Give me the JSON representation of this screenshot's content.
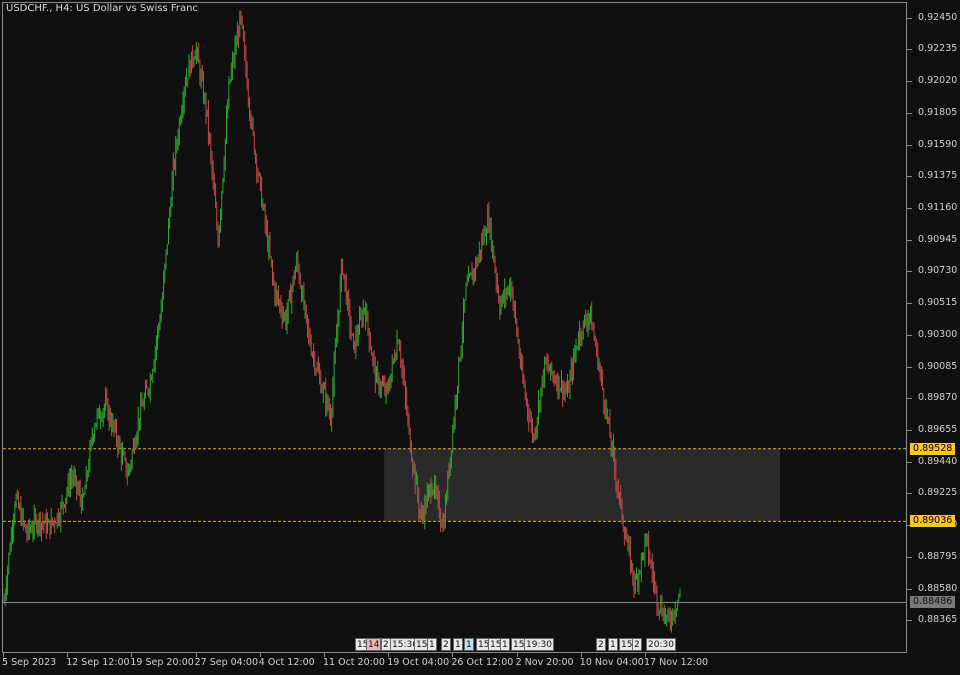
{
  "title": "USDCHF., H4:  US Dollar vs Swiss Franc",
  "colors": {
    "background": "#101010",
    "bull": "#2fa82f",
    "bear": "#c04a4a",
    "level_line": "#e0b030",
    "zone": "#2a2a2a",
    "current_line": "#8c8c8c"
  },
  "price_tags": [
    {
      "label": "0.89528",
      "style": "gold"
    },
    {
      "label": "0.89036",
      "style": "gold"
    },
    {
      "label": "0.88486",
      "style": "grey"
    }
  ],
  "event_markers": [
    "15",
    "14",
    "2",
    "15:30",
    "15",
    "1",
    "2",
    "1",
    "1",
    "15",
    "15",
    "1",
    "15",
    "19:30",
    "2",
    "1",
    "15",
    "2",
    "20:30"
  ],
  "chart_data": {
    "type": "candlestick",
    "symbol": "USDCHF.",
    "timeframe": "H4",
    "description": "US Dollar vs Swiss Franc",
    "ylim": [
      0.8815,
      0.9255
    ],
    "yticks": [
      0.9245,
      0.92235,
      0.9202,
      0.91805,
      0.9159,
      0.91375,
      0.9116,
      0.90945,
      0.9073,
      0.90515,
      0.903,
      0.90085,
      0.8987,
      0.89655,
      0.8944,
      0.89225,
      0.8901,
      0.88795,
      0.8858,
      0.88365
    ],
    "ytick_labels": [
      "0.92450",
      "0.92235",
      "0.92020",
      "0.91805",
      "0.91590",
      "0.91375",
      "0.91160",
      "0.90945",
      "0.90730",
      "0.90515",
      "0.90300",
      "0.90085",
      "0.89870",
      "0.89655",
      "0.89440",
      "0.89225",
      "0.89010",
      "0.88795",
      "0.88580",
      "0.88365"
    ],
    "xtick_labels": [
      "5 Sep 2023",
      "12 Sep 12:00",
      "19 Sep 20:00",
      "27 Sep 04:00",
      "4 Oct 12:00",
      "11 Oct 20:00",
      "19 Oct 04:00",
      "26 Oct 12:00",
      "2 Nov 20:00",
      "10 Nov 04:00",
      "17 Nov 12:00"
    ],
    "levels": [
      0.89528,
      0.89036
    ],
    "current_price": 0.88486,
    "zone": {
      "from": "19 Oct 04:00",
      "to_after": "17 Nov 12:00",
      "high": 0.89528,
      "low": 0.89036
    },
    "path": [
      0.885,
      0.892,
      0.8895,
      0.8905,
      0.89,
      0.891,
      0.8935,
      0.8915,
      0.897,
      0.8983,
      0.896,
      0.8935,
      0.8975,
      0.9,
      0.905,
      0.914,
      0.92,
      0.9225,
      0.918,
      0.9095,
      0.92,
      0.9245,
      0.917,
      0.9115,
      0.906,
      0.904,
      0.908,
      0.903,
      0.9,
      0.8975,
      0.908,
      0.902,
      0.905,
      0.9,
      0.899,
      0.903,
      0.896,
      0.8905,
      0.893,
      0.89,
      0.898,
      0.906,
      0.908,
      0.911,
      0.905,
      0.9065,
      0.9,
      0.896,
      0.901,
      0.9,
      0.899,
      0.903,
      0.9045,
      0.9,
      0.895,
      0.89,
      0.886,
      0.889,
      0.885,
      0.8835,
      0.8855
    ]
  }
}
